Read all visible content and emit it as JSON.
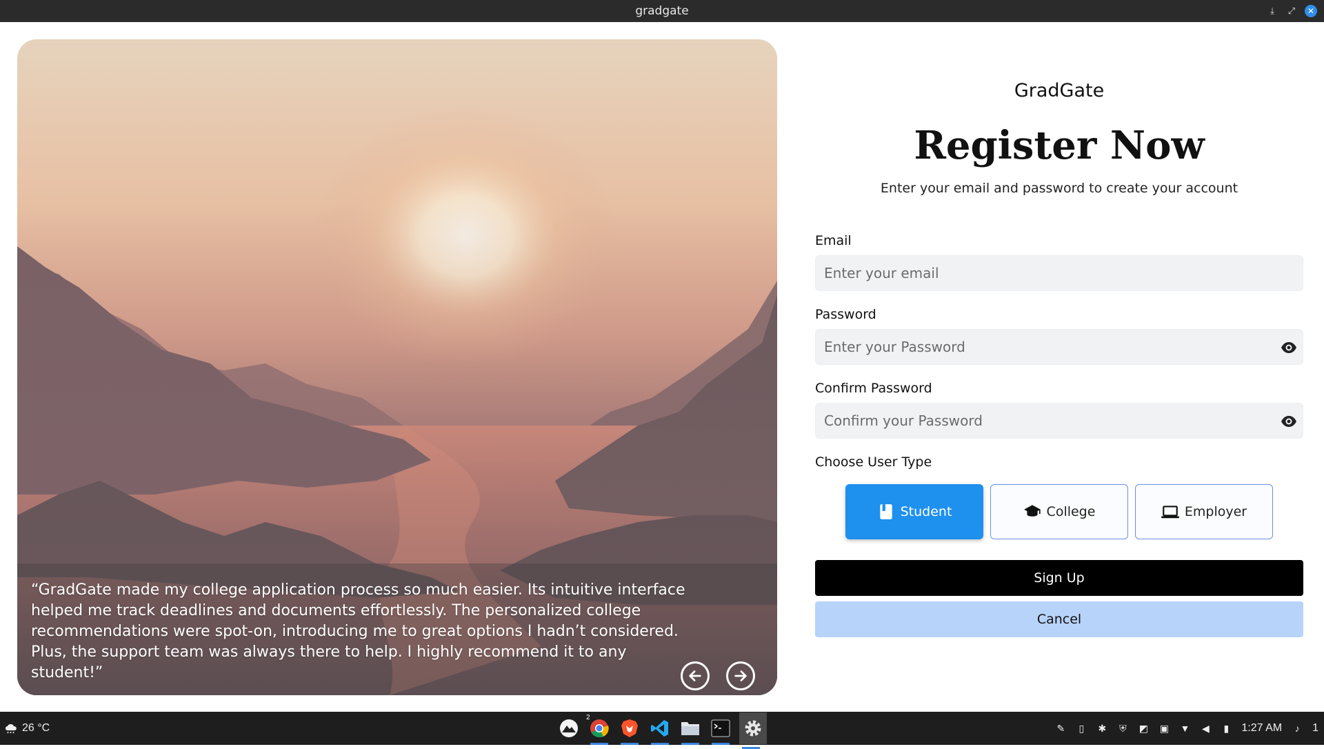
{
  "window": {
    "title": "gradgate",
    "controls": [
      "minimize",
      "restore",
      "close"
    ]
  },
  "hero": {
    "quote": "“GradGate made my college application process so much easier. Its intuitive interface helped me track deadlines and documents effortlessly. The personalized college recommendations were spot-on, introducing me to great options I hadn’t considered. Plus, the support team was always there to help. I highly recommend it to any student!”",
    "prev_icon": "arrow-left-circle-icon",
    "next_icon": "arrow-right-circle-icon"
  },
  "form": {
    "brand": "GradGate",
    "heading": "Register Now",
    "subheading": "Enter your email and password to create your account",
    "email": {
      "label": "Email",
      "placeholder": "Enter your email",
      "value": ""
    },
    "password": {
      "label": "Password",
      "placeholder": "Enter your Password",
      "value": ""
    },
    "confirm": {
      "label": "Confirm Password",
      "placeholder": "Confirm your Password",
      "value": ""
    },
    "user_type": {
      "label": "Choose User Type",
      "selected": "Student",
      "options": [
        {
          "label": "Student",
          "icon": "book-icon"
        },
        {
          "label": "College",
          "icon": "graduation-cap-icon"
        },
        {
          "label": "Employer",
          "icon": "laptop-icon"
        }
      ]
    },
    "signup_label": "Sign Up",
    "cancel_label": "Cancel"
  },
  "colors": {
    "accent": "#1e90ee",
    "option_border": "#6c8fe0",
    "cancel_bg": "#b8d3f9",
    "signup_bg": "#000000",
    "input_bg": "#f1f2f4"
  },
  "taskbar": {
    "weather": "26 °C",
    "dock": [
      "app-launcher",
      "chrome",
      "brave",
      "vscode",
      "files",
      "terminal",
      "settings"
    ],
    "chrome_badge": "2",
    "clock": "1:27 AM",
    "notification_count": "1"
  }
}
